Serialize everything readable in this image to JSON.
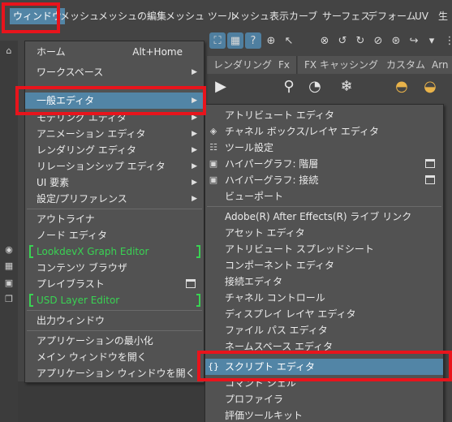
{
  "menubar": {
    "items": [
      "ウィンドウ",
      "メッシュ",
      "メッシュの編集",
      "メッシュ ツール",
      "メッシュ表示",
      "カーブ",
      "サーフェス",
      "デフォーム",
      "UV",
      "生"
    ]
  },
  "shelf": {
    "tabs": [
      "レンダリング",
      "Fx",
      "FX キャッシング",
      "カスタム",
      "Arn"
    ]
  },
  "window_menu": {
    "items": [
      {
        "label": "ホーム",
        "shortcut": "Alt+Home"
      },
      {
        "label": "ワークスペース"
      },
      {
        "label": "一般エディタ"
      },
      {
        "label": "モデリング エディタ"
      },
      {
        "label": "アニメーション エディタ"
      },
      {
        "label": "レンダリング エディタ"
      },
      {
        "label": "リレーションシップ エディタ"
      },
      {
        "label": "UI 要素"
      },
      {
        "label": "設定/プリファレンス"
      },
      {
        "label": "アウトライナ"
      },
      {
        "label": "ノード エディタ"
      },
      {
        "label": "LookdevX Graph Editor"
      },
      {
        "label": "コンテンツ ブラウザ"
      },
      {
        "label": "プレイブラスト"
      },
      {
        "label": "USD Layer Editor"
      },
      {
        "label": "出力ウィンドウ"
      },
      {
        "label": "アプリケーションの最小化"
      },
      {
        "label": "メイン ウィンドウを開く"
      },
      {
        "label": "アプリケーション ウィンドウを開く"
      }
    ]
  },
  "general_editors_menu": {
    "items": [
      {
        "label": "アトリビュート エディタ"
      },
      {
        "label": "チャネル ボックス/レイヤ エディタ"
      },
      {
        "label": "ツール設定"
      },
      {
        "label": "ハイパーグラフ: 階層"
      },
      {
        "label": "ハイパーグラフ: 接続"
      },
      {
        "label": "ビューポート"
      },
      {
        "label": "Adobe(R) After Effects(R) ライブ リンク"
      },
      {
        "label": "アセット エディタ"
      },
      {
        "label": "アトリビュート スプレッドシート"
      },
      {
        "label": "コンポーネント エディタ"
      },
      {
        "label": "接続エディタ"
      },
      {
        "label": "チャネル コントロール"
      },
      {
        "label": "ディスプレイ レイヤ エディタ"
      },
      {
        "label": "ファイル パス エディタ"
      },
      {
        "label": "ネームスペース エディタ"
      },
      {
        "label": "スクリプト エディタ"
      },
      {
        "label": "コマンド シェル"
      },
      {
        "label": "プロファイラ"
      },
      {
        "label": "評価ツールキット"
      }
    ]
  },
  "colors": {
    "highlight": "#5285a6",
    "annotation": "#e8141c",
    "lookdev_green": "#39d353",
    "menu_bg": "#525252"
  }
}
